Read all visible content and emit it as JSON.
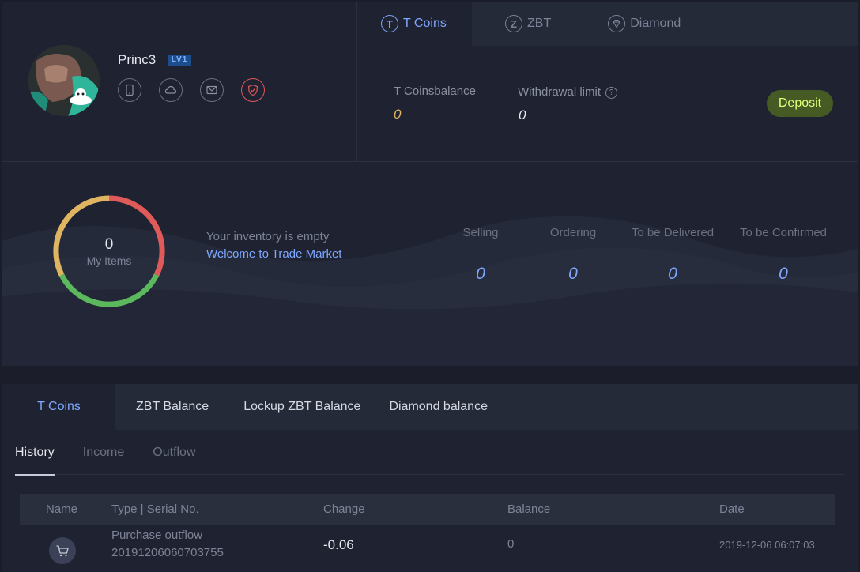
{
  "profile": {
    "username": "Princ3",
    "level_badge": "LV1",
    "verify_icons": [
      "phone-icon",
      "cloud-icon",
      "mail-icon",
      "shield-check-icon"
    ]
  },
  "wallet": {
    "tabs": [
      {
        "label": "T Coins",
        "icon": "T"
      },
      {
        "label": "ZBT",
        "icon": "Z"
      },
      {
        "label": "Diamond",
        "icon": "diamond-icon"
      }
    ],
    "balance_label": "T Coinsbalance",
    "balance_value": "0",
    "withdrawal_label": "Withdrawal limit",
    "withdrawal_value": "0",
    "deposit_label": "Deposit"
  },
  "stats": {
    "ring_count": "0",
    "ring_label": "My Items",
    "empty_text": "Your inventory is empty",
    "welcome_link": "Welcome to Trade Market",
    "items": [
      {
        "label": "Selling",
        "value": "0"
      },
      {
        "label": "Ordering",
        "value": "0"
      },
      {
        "label": "To be Delivered",
        "value": "0"
      },
      {
        "label": "To be Confirmed",
        "value": "0"
      }
    ]
  },
  "main_tabs": [
    "T Coins",
    "ZBT Balance",
    "Lockup ZBT Balance",
    "Diamond balance"
  ],
  "sub_tabs": [
    "History",
    "Income",
    "Outflow"
  ],
  "table": {
    "headers": [
      "Name",
      "Type | Serial No.",
      "Change",
      "Balance",
      "Date"
    ],
    "rows": [
      {
        "icon": "cart-icon",
        "type": "Purchase outflow",
        "serial": "20191206060703755",
        "change": "-0.06",
        "balance": "0",
        "date": "2019-12-06 06:07:03"
      }
    ]
  },
  "colors": {
    "accent": "#7fa8ff",
    "balance_gold": "#e0b562",
    "deposit_bg": "#465a23",
    "deposit_text": "#e2ff7a",
    "ring_red": "#e05a5a",
    "ring_green": "#5cb85c",
    "ring_yellow": "#e0b562"
  }
}
